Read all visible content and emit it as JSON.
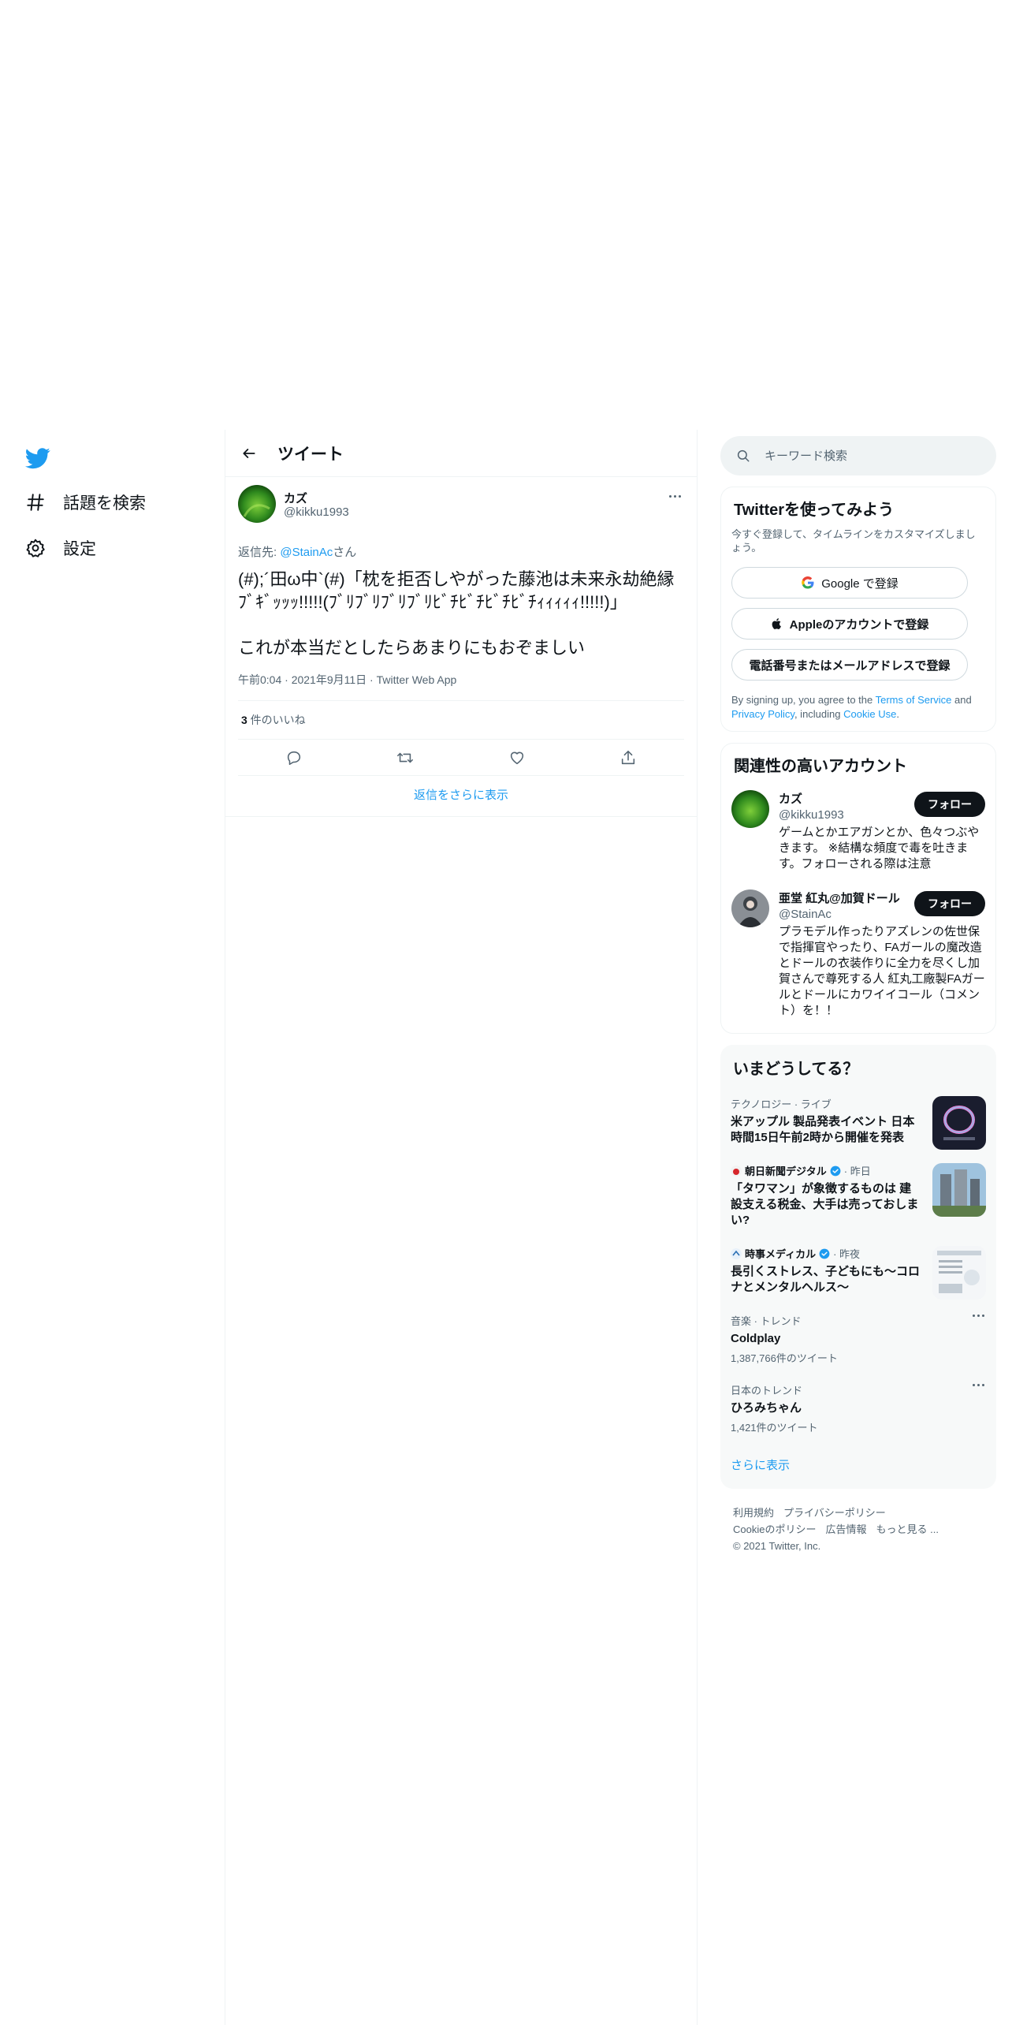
{
  "nav": {
    "items": [
      {
        "label": "話題を検索",
        "icon": "hashtag-icon"
      },
      {
        "label": "設定",
        "icon": "gear-icon"
      }
    ]
  },
  "header": {
    "title": "ツイート"
  },
  "tweet": {
    "author_name": "カズ",
    "author_handle": "@kikku1993",
    "reply_prefix": "返信先: ",
    "reply_mention": "@StainAc",
    "reply_suffix": "さん",
    "text": "(#);´田ω中`(#)「枕を拒否しやがった藤池は未来永劫絶縁ﾌﾞｷﾞｯｯｯ!!!!!(ﾌﾞﾘﾌﾞﾘﾌﾞﾘﾌﾞﾘﾋﾞﾁﾋﾞﾁﾋﾞﾁﾋﾞﾁｨｨｨｨｨ!!!!!)」\n\nこれが本当だとしたらあまりにもおぞましい",
    "meta": "午前0:04 · 2021年9月11日 · Twitter Web App",
    "likes_count": "3",
    "likes_label": " 件のいいね",
    "more_replies": "返信をさらに表示"
  },
  "search": {
    "placeholder": "キーワード検索"
  },
  "signup": {
    "title": "Twitterを使ってみよう",
    "subtitle": "今すぐ登録して、タイムラインをカスタマイズしましょう。",
    "google": "Google で登録",
    "apple": "Appleのアカウントで登録",
    "phone": "電話番号またはメールアドレスで登録",
    "terms_1": "By signing up, you agree to the ",
    "terms_link1": "Terms of Service",
    "terms_2": " and ",
    "terms_link2": "Privacy Policy",
    "terms_3": ", including ",
    "terms_link3": "Cookie Use",
    "terms_4": "."
  },
  "related": {
    "title": "関連性の高いアカウント",
    "follow_label": "フォロー",
    "accounts": [
      {
        "name": "カズ",
        "handle": "@kikku1993",
        "bio": "ゲームとかエアガンとか、色々つぶやきます。 ※結構な頻度で毒を吐きます。フォローされる際は注意"
      },
      {
        "name": "亜堂 紅丸@加賀ドール",
        "handle": "@StainAc",
        "bio": "プラモデル作ったりアズレンの佐世保で指揮官やったり、FAガールの魔改造とドールの衣装作りに全力を尽くし加賀さんで尊死する人 紅丸工廠製FAガールとドールにカワイイコール（コメント）を！！"
      }
    ]
  },
  "trends": {
    "title": "いまどうしてる？",
    "items": [
      {
        "meta": "テクノロジー · ライブ",
        "headline": "米アップル 製品発表イベント 日本時間15日午前2時から開催を発表"
      },
      {
        "source": "朝日新聞デジタル",
        "when": " · 昨日",
        "headline": "「タワマン」が象徴するものは 建設支える税金、大手は売っておしまい?"
      },
      {
        "source": "時事メディカル",
        "when": " · 昨夜",
        "headline": "長引くストレス、子どもにも～コロナとメンタルヘルス～"
      },
      {
        "meta": "音楽 · トレンド",
        "headline": "Coldplay",
        "count": "1,387,766件のツイート"
      },
      {
        "meta": "日本のトレンド",
        "headline": "ひろみちゃん",
        "count": "1,421件のツイート"
      }
    ],
    "show_more": "さらに表示"
  },
  "footer": {
    "links": [
      "利用規約",
      "プライバシーポリシー",
      "Cookieのポリシー",
      "広告情報",
      "もっと見る ..."
    ],
    "copyright": "© 2021 Twitter, Inc."
  },
  "colors": {
    "accent": "#1d9bf0",
    "text": "#0f1419",
    "muted": "#536471"
  }
}
